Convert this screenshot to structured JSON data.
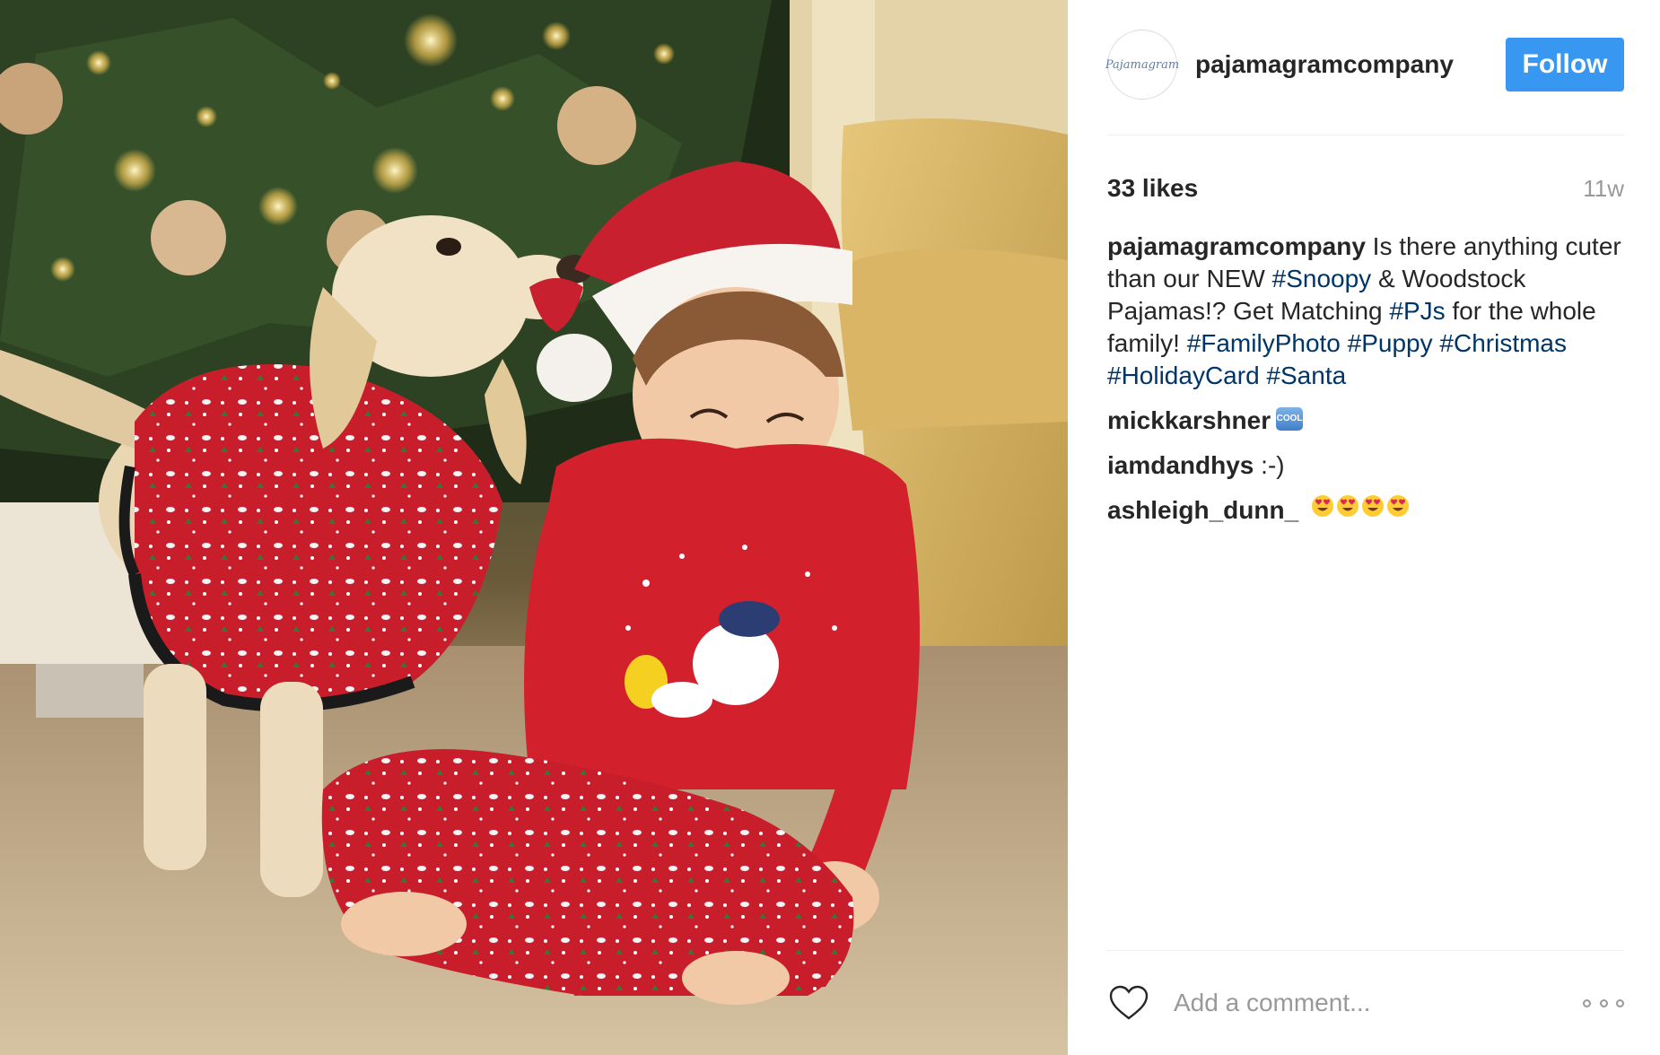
{
  "photo": {
    "alt_subject": "child-and-puppy-in-snoopy-pajamas"
  },
  "account": {
    "avatar_text": "Pajamagram",
    "username": "pajamagramcompany",
    "follow_label": "Follow"
  },
  "stats": {
    "likes": "33 likes",
    "time_ago": "11w"
  },
  "caption": {
    "author": "pajamagramcompany",
    "parts": [
      {
        "text": " Is there anything cuter than our NEW ",
        "tag": false
      },
      {
        "text": "#Snoopy",
        "tag": true
      },
      {
        "text": " & Woodstock Pajamas!? Get Matching ",
        "tag": false
      },
      {
        "text": "#PJs",
        "tag": true
      },
      {
        "text": " for the whole family! ",
        "tag": false
      },
      {
        "text": "#FamilyPhoto",
        "tag": true
      },
      {
        "text": " ",
        "tag": false
      },
      {
        "text": "#Puppy",
        "tag": true
      },
      {
        "text": " ",
        "tag": false
      },
      {
        "text": "#Christmas",
        "tag": true
      },
      {
        "text": " ",
        "tag": false
      },
      {
        "text": "#HolidayCard",
        "tag": true
      },
      {
        "text": " ",
        "tag": false
      },
      {
        "text": "#Santa",
        "tag": true
      }
    ]
  },
  "comments": [
    {
      "author": "mickkarshner",
      "text": "",
      "emoji": "cool-icon",
      "emoji_label": "COOL"
    },
    {
      "author": "iamdandhys",
      "text": " :-)",
      "emoji": null
    },
    {
      "author": "ashleigh_dunn_",
      "text": "",
      "emoji": "heart-eyes-icon",
      "emoji_count": 4
    }
  ],
  "footer": {
    "comment_placeholder": "Add a comment...",
    "like_icon": "heart-outline-icon",
    "more_icon": "more-options-icon"
  },
  "colors": {
    "follow_button": "#3897f0",
    "hashtag": "#003569",
    "muted": "#999999",
    "text": "#262626"
  }
}
